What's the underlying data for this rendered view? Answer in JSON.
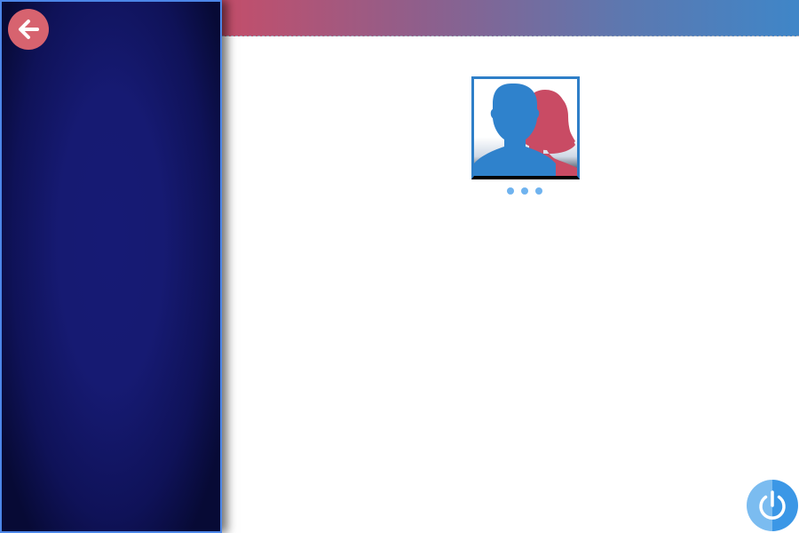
{
  "screen": {
    "title": ""
  },
  "navigation": {
    "back_icon": "arrow-left-icon"
  },
  "profile": {
    "avatar_icon": "users-couple-icon",
    "loading_indicator": "three-dots"
  },
  "system": {
    "power_icon": "power-icon"
  },
  "colors": {
    "banner_start": "#c44e6a",
    "banner_end": "#3f86c8",
    "panel_bg": "#161a74",
    "panel_border": "#4c86e8",
    "back_button": "#d7636f",
    "avatar_male": "#2f82cc",
    "avatar_female": "#c94b64",
    "dots": "#6fb3ef",
    "power_button": "#3b97e6"
  }
}
